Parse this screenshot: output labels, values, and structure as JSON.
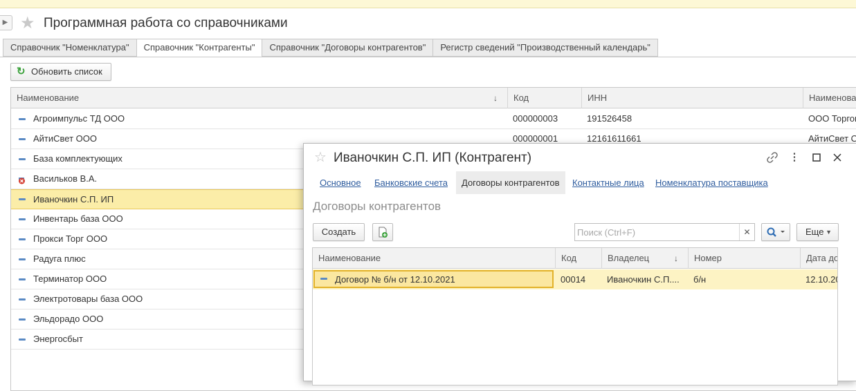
{
  "header": {
    "title": "Программная работа со справочниками"
  },
  "tabs": [
    {
      "label": "Справочник \"Номенклатура\""
    },
    {
      "label": "Справочник \"Контрагенты\"",
      "active": true
    },
    {
      "label": "Справочник \"Договоры контрагентов\""
    },
    {
      "label": "Регистр сведений \"Производственный календарь\""
    }
  ],
  "toolbar": {
    "refresh_label": "Обновить список"
  },
  "main_table": {
    "columns": [
      "Наименование",
      "Код",
      "ИНН",
      "Наименова"
    ],
    "rows": [
      {
        "name": "Агроимпульс ТД ООО",
        "code": "000000003",
        "inn": "191526458",
        "fullname": "ООО Торгов"
      },
      {
        "name": "АйтиСвет ООО",
        "code": "000000001",
        "inn": "12161611661",
        "fullname": "АйтиСвет О"
      },
      {
        "name": "База комплектующих",
        "code": "",
        "inn": "",
        "fullname": ""
      },
      {
        "name": "Васильков В.А.",
        "code": "",
        "inn": "",
        "fullname": "",
        "deleted": true
      },
      {
        "name": "Иваночкин С.П. ИП",
        "code": "",
        "inn": "",
        "fullname": "",
        "selected": true
      },
      {
        "name": "Инвентарь база ООО",
        "code": "",
        "inn": "",
        "fullname": ""
      },
      {
        "name": "Прокси Торг ООО",
        "code": "",
        "inn": "",
        "fullname": ""
      },
      {
        "name": "Радуга плюс",
        "code": "",
        "inn": "",
        "fullname": ""
      },
      {
        "name": "Терминатор ООО",
        "code": "",
        "inn": "",
        "fullname": ""
      },
      {
        "name": "Электротовары база ООО",
        "code": "",
        "inn": "",
        "fullname": ""
      },
      {
        "name": "Эльдорадо ООО",
        "code": "",
        "inn": "",
        "fullname": ""
      },
      {
        "name": "Энергосбыт",
        "code": "",
        "inn": "",
        "fullname": ""
      }
    ]
  },
  "dialog": {
    "title": "Иваночкин С.П. ИП (Контрагент)",
    "links": [
      {
        "label": "Основное"
      },
      {
        "label": "Банковские счета"
      },
      {
        "label": "Договоры контрагентов",
        "active": true
      },
      {
        "label": "Контактные лица"
      },
      {
        "label": "Номенклатура поставщика"
      }
    ],
    "section_title": "Договоры контрагентов",
    "create_label": "Создать",
    "search_placeholder": "Поиск (Ctrl+F)",
    "search_value": "",
    "more_label": "Еще",
    "table": {
      "columns": [
        "Наименование",
        "Код",
        "Владелец",
        "Номер",
        "Дата до"
      ],
      "rows": [
        {
          "name": "Договор № б/н от 12.10.2021",
          "code": "00014",
          "owner": "Иваночкин С.П....",
          "number": "б/н",
          "date": "12.10.20"
        }
      ]
    }
  },
  "colors": {
    "selection": "#fbeda8",
    "link": "#2e5c9e",
    "refresh_icon": "#3aa13a",
    "item_icon": "#5a8ac4"
  }
}
